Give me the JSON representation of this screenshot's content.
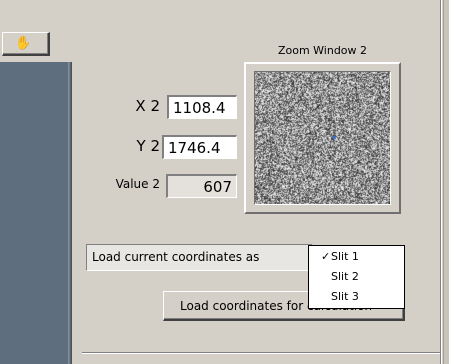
{
  "toolbar": {
    "hand_icon": "hand-pan-icon"
  },
  "zoom": {
    "title": "Zoom Window 2"
  },
  "fields": {
    "x_label": "X 2",
    "x_value": "1108.4",
    "y_label": "Y 2",
    "y_value": "1746.4",
    "value_label": "Value 2",
    "value_value": "607"
  },
  "load": {
    "label": "Load current coordinates as",
    "options": [
      {
        "label": "Slit 1",
        "checked": true
      },
      {
        "label": "Slit 2",
        "checked": false
      },
      {
        "label": "Slit 3",
        "checked": false
      }
    ],
    "button_label": "Load coordinates for calculation"
  },
  "colors": {
    "panel_bg": "#d4d0c8",
    "left_panel": "#5f6e7e",
    "marker": "#3a6fd8"
  }
}
